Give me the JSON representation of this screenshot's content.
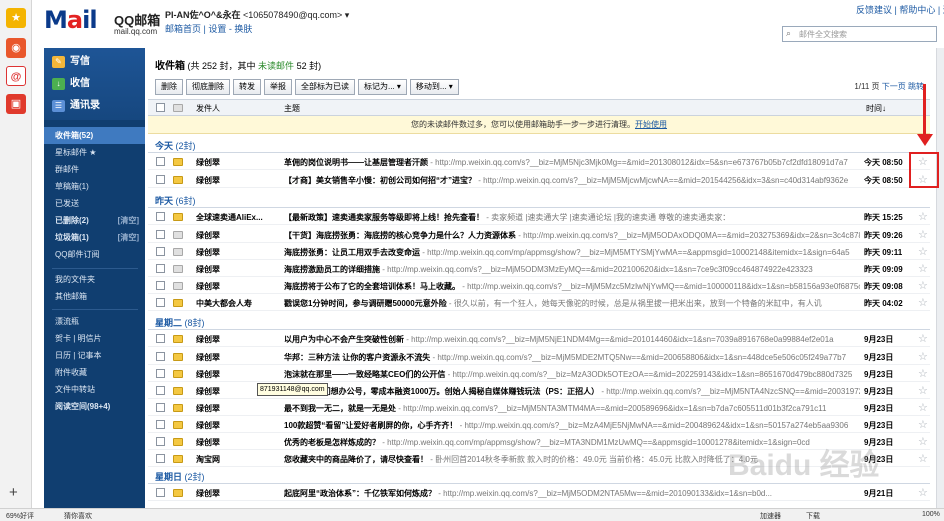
{
  "header": {
    "logo_text": "M",
    "logo_o": "a",
    "logo_rest": "il",
    "brand": "QQ邮箱",
    "domain": "mail.qq.com",
    "user_name": "PI-AN佐^O^&永在",
    "user_email": "<1065078490@qq.com>",
    "links": "邮箱首页 | 设置 - 换肤",
    "top_links": "反馈建议 | 帮助中心 | 退出",
    "search_placeholder": "邮件全文搜索"
  },
  "sidebar": {
    "compose": "写信",
    "inbox": "收信",
    "contacts": "通讯录",
    "items": [
      {
        "label": "收件箱(52)",
        "clear": ""
      },
      {
        "label": "星标邮件 ★",
        "clear": ""
      },
      {
        "label": "群邮件",
        "clear": ""
      },
      {
        "label": "草稿箱(1)",
        "clear": ""
      },
      {
        "label": "已发送",
        "clear": ""
      },
      {
        "label": "已删除(2)",
        "clear": "[清空]"
      },
      {
        "label": "垃圾箱(1)",
        "clear": "[清空]"
      },
      {
        "label": "QQ邮件订阅",
        "clear": ""
      },
      {
        "label": "我的文件夹",
        "clear": ""
      },
      {
        "label": "其他邮箱",
        "clear": ""
      },
      {
        "label": "漂流瓶",
        "clear": ""
      },
      {
        "label": "贺卡 | 明信片",
        "clear": ""
      },
      {
        "label": "日历 | 记事本",
        "clear": ""
      },
      {
        "label": "附件收藏",
        "clear": ""
      },
      {
        "label": "文件中转站",
        "clear": ""
      },
      {
        "label": "阅读空间(98+4)",
        "clear": ""
      }
    ]
  },
  "main": {
    "title": "收件箱",
    "count_text": "(共 252 封，其中",
    "unread_text": "未读邮件",
    "unread_count": "52 封)",
    "toolbar": [
      "删除",
      "彻底删除",
      "转发",
      "举报",
      "全部标为已读",
      "标记为... ▾",
      "移动到... ▾"
    ],
    "pager": "1/11 页",
    "pager_next": "下一页 跳转",
    "col_from": "发件人",
    "col_subject": "主题",
    "col_time": "时间↓",
    "tip": "您的未读邮件数过多，您可以使用邮箱助手一步一步进行清理。",
    "tip_link": "开始使用",
    "groups": [
      {
        "label": "今天",
        "count": "(2封)"
      },
      {
        "label": "昨天",
        "count": "(6封)"
      },
      {
        "label": "星期二",
        "count": "(8封)"
      },
      {
        "label": "星期日",
        "count": "(2封)"
      }
    ],
    "rows": [
      {
        "from": "绿创翠",
        "subject": "革佣的岗位说明书——让基层管理者汗颜",
        "preview": " - http://mp.weixin.qq.com/s?__biz=MjM5Njc3Mjk0Mg==&mid=201308012&idx=5&sn=e673767b05b7cf2dfd18091d7a7",
        "time": "今天 08:50"
      },
      {
        "from": "绿创翠",
        "subject": "【才商】美女销售辛小慢：初创公司如何招“才”进宝？",
        "preview": " - http://mp.weixin.qq.com/s?__biz=MjM5MjcwMjcwNA==&mid=201544256&idx=3&sn=c40d314abf9362e",
        "time": "今天 08:50"
      },
      {
        "from": "全球速卖通AliEx...",
        "subject": "【最新政策】速卖通卖家服务等级即将上线！抢先查看！",
        "preview": " - 卖家频道 |速卖通大学 |速卖通论坛 |我的速卖通      尊敬的速卖通卖家：",
        "time": "昨天 15:25"
      },
      {
        "from": "绿创翠",
        "subject": "【干货】海底捞张勇：海底捞的核心竞争力是什么？人力资源体系",
        "preview": " - http://mp.weixin.qq.com/s?__biz=MjM5ODAxODQ0MA==&mid=203275369&idx=2&sn=3c4c878bf",
        "time": "昨天 09:26"
      },
      {
        "from": "绿创翠",
        "subject": "海底捞张勇：让员工用双手去改变命运",
        "preview": " - http://mp.weixin.qq.com/mp/appmsg/show?__biz=MjM5MTYSMjYwMA==&appmsgid=10002148&itemidx=1&sign=64a5",
        "time": "昨天 09:11"
      },
      {
        "from": "绿创翠",
        "subject": "海底捞激励员工的详细措施",
        "preview": " - http://mp.weixin.qq.com/s?__biz=MjM5ODM3MzEyMQ==&mid=202100620&idx=1&sn=7ce9c3f09cc464874922e423323",
        "time": "昨天 09:09"
      },
      {
        "from": "绿创翠",
        "subject": "海底捞将于公布了它的全套培训体系！马上收藏。",
        "preview": " - http://mp.weixin.qq.com/s?__biz=MjM5Mzc5MzIwNjYwMQ==&mid=100000118&idx=1&sn=b58156a93e0f6875cb3d8",
        "time": "昨天 09:08"
      },
      {
        "from": "中美大都会人寿",
        "subject": "戳误您1分钟时间，参与调研赠50000元意外险",
        "preview": " - 很久以前，有一个狂人，她每天像驼的时候，总是从祸里拔一把米出来，放到一个特备的米缸中，有人讥",
        "time": "昨天 04:02"
      },
      {
        "from": "绿创翠",
        "subject": "以用户为中心不会产生突破性创新",
        "preview": " - http://mp.weixin.qq.com/s?__biz=MjM5NjE1NDM4Mg==&mid=201014460&idx=1&sn=7039a8916768e0a99884ef2e01a",
        "time": "9月23日"
      },
      {
        "from": "绿创翠",
        "subject": "华邦：三种方法 让你的客户资源永不流失",
        "preview": " - http://mp.weixin.qq.com/s?__biz=MjM5MDE2MTQ5Nw==&mid=200658806&idx=1&sn=448dce5e506c05f249a77b7",
        "time": "9月23日"
      },
      {
        "from": "绿创翠",
        "subject": "泡沫就在那里——一致经略某CEO们的公开信",
        "preview": " - http://mp.weixin.qq.com/s?__biz=MzA3ODk5OTEzOA==&mid=202259143&idx=1&sn=8651670d479bc880d7325",
        "time": "9月23日"
      },
      {
        "from": "绿创翠",
        "subject": "7元公了 我们想办公号，零成本融资1000万。创始人揭秘自媒体赚钱玩法（PS：正招人）",
        "preview": " - http://mp.weixin.qq.com/s?__biz=MjM5NTA4NzcSNQ==&mid=200319723",
        "time": "9月23日"
      },
      {
        "from": "绿创翠",
        "subject": "最不到我一无二，就是一无是处",
        "preview": " - http://mp.weixin.qq.com/s?__biz=MjM5NTA3MTM4MA==&mid=200589696&idx=1&sn=b7da7c605511d01b3f2ca791c11",
        "time": "9月23日"
      },
      {
        "from": "绿创翠",
        "subject": "100款超赞“看留”让爱好者刷屏的你，心手齐齐！",
        "preview": " - http://mp.weixin.qq.com/s?__biz=MzA4MjE5NjMwNA==&mid=200489624&idx=1&sn=50157a274eb5aa9306",
        "time": "9月23日"
      },
      {
        "from": "绿创翠",
        "subject": "优秀的老板是怎样炼成的？",
        "preview": " - http://mp.weixin.qq.com/mp/appmsg/show?__biz=MTA3NDM1MzUwMQ==&appmsgid=10001278&itemidx=1&sign=0cd",
        "time": "9月23日"
      },
      {
        "from": "淘宝网",
        "subject": "您收藏夹中的商品降价了，请尽快查看！",
        "preview": " - 卧州回首2014秋冬季新款 款入时的价格：49.0元 当前价格：45.0元 比款入时降低了：4.0元",
        "time": "9月23日"
      },
      {
        "from": "绿创翠",
        "subject": "起底阿里“政治体系”：千亿铁军如何炼成？",
        "preview": " - http://mp.weixin.qq.com/s?__biz=MjM5ODM2NTA5Mw==&mid=201090133&idx=1&sn=b0d...",
        "time": "9月21日"
      }
    ],
    "tooltip": "871931148@qq.com"
  },
  "statusbar": {
    "left1": "69%好评",
    "left2": "猜你喜欢",
    "right1": "加速器",
    "right2": "下载",
    "right3": "100%"
  },
  "watermark": "Baidu 经验"
}
